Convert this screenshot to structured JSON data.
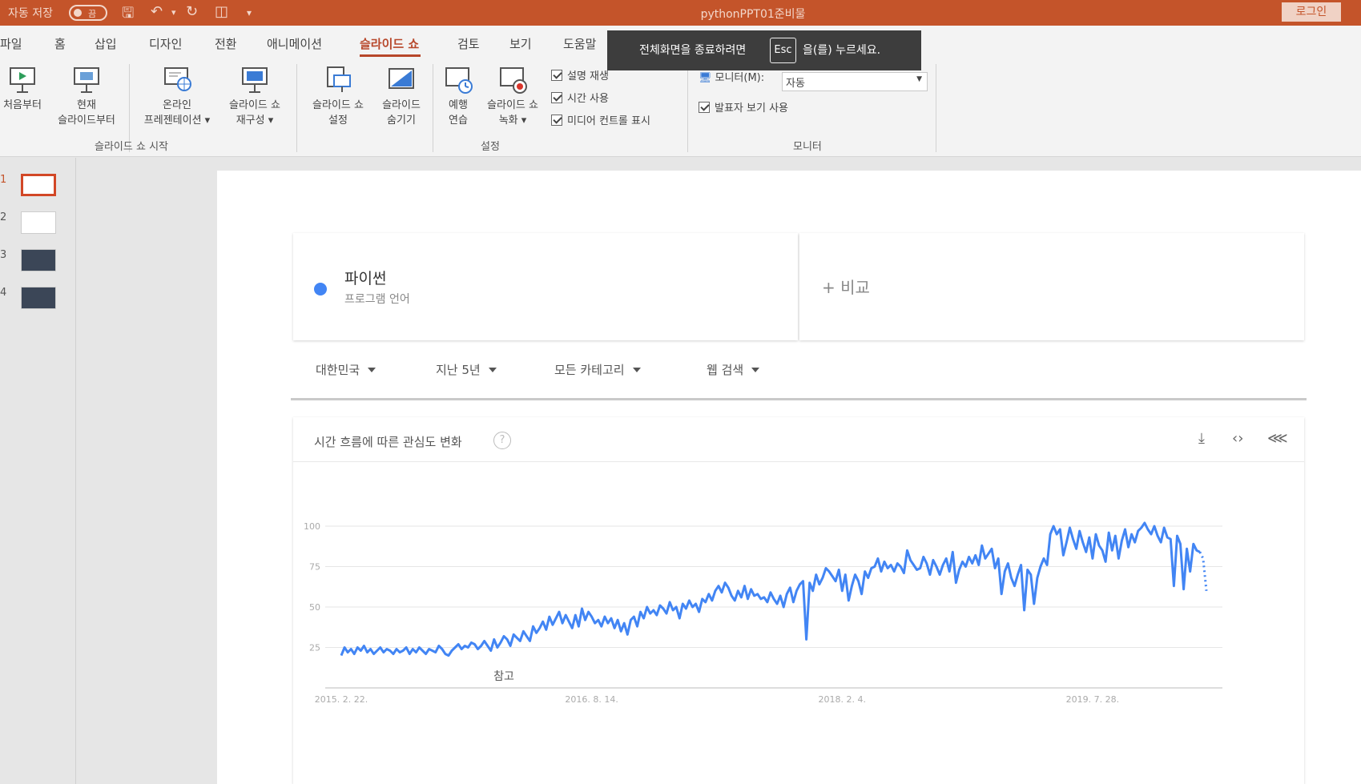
{
  "titlebar": {
    "autosave_label": "자동 저장",
    "toggle_state": "끔",
    "doc_title": "pythonPPT01준비물",
    "login_label": "로그인"
  },
  "ribbon_tabs": [
    "파일",
    "홈",
    "삽입",
    "디자인",
    "전환",
    "애니메이션",
    "슬라이드 쇼",
    "검토",
    "보기",
    "도움말"
  ],
  "active_tab": "슬라이드 쇼",
  "ribbon": {
    "start_group": {
      "label": "슬라이드 쇼 시작",
      "buttons": [
        {
          "line1": "처음부터",
          "line2": ""
        },
        {
          "line1": "현재",
          "line2": "슬라이드부터"
        },
        {
          "line1": "온라인",
          "line2": "프레젠테이션 ▾"
        },
        {
          "line1": "슬라이드 쇼",
          "line2": "재구성 ▾"
        }
      ]
    },
    "setup_group": {
      "label": "설정",
      "buttons": [
        {
          "line1": "슬라이드 쇼",
          "line2": "설정"
        },
        {
          "line1": "슬라이드",
          "line2": "숨기기"
        },
        {
          "line1": "예행",
          "line2": "연습"
        },
        {
          "line1": "슬라이드 쇼",
          "line2": "녹화 ▾"
        }
      ],
      "checkboxes": [
        "설명 재생",
        "시간 사용",
        "미디어 컨트롤 표시"
      ]
    },
    "monitor_group": {
      "label": "모니터",
      "monitor_label": "모니터(M):",
      "monitor_value": "자동",
      "presenter_view": "발표자 보기 사용"
    }
  },
  "esc_tip": {
    "pre": "전체화면을 종료하려면",
    "key": "Esc",
    "post": "을(를) 누르세요."
  },
  "thumbnails": [
    "1",
    "2",
    "3",
    "4"
  ],
  "slide": {
    "term_name": "파이썬",
    "term_sub": "프로그램 언어",
    "compare_label": "+ 비교",
    "filters": [
      "대한민국",
      "지난 5년",
      "모든 카테고리",
      "웹 검색"
    ],
    "chart_title": "시간 흐름에 따른 관심도 변화",
    "annotation": "참고"
  },
  "chart_data": {
    "type": "line",
    "title": "시간 흐름에 따른 관심도 변화",
    "ylim": [
      0,
      100
    ],
    "y_ticks": [
      25,
      50,
      75,
      100
    ],
    "x_tick_labels": [
      "2015. 2. 22.",
      "2016. 8. 14.",
      "2018. 2. 4.",
      "2019. 7. 28."
    ],
    "x_tick_index": [
      0,
      77,
      154,
      231
    ],
    "grid": true,
    "line_color": "#4285f4",
    "series": [
      {
        "values": [
          20,
          25,
          22,
          24,
          21,
          25,
          23,
          26,
          22,
          24,
          21,
          23,
          25,
          22,
          24,
          23,
          21,
          24,
          22,
          23,
          25,
          21,
          24,
          22,
          25,
          23,
          21,
          24,
          23,
          22,
          26,
          24,
          21,
          20,
          23,
          25,
          27,
          24,
          26,
          25,
          28,
          27,
          24,
          26,
          29,
          26,
          23,
          30,
          25,
          28,
          32,
          30,
          26,
          33,
          31,
          29,
          35,
          32,
          29,
          38,
          34,
          37,
          41,
          36,
          44,
          39,
          43,
          47,
          40,
          45,
          41,
          37,
          45,
          38,
          49,
          42,
          47,
          44,
          40,
          42,
          38,
          44,
          40,
          43,
          37,
          42,
          35,
          40,
          33,
          42,
          44,
          38,
          47,
          43,
          50,
          46,
          48,
          45,
          51,
          49,
          46,
          53,
          48,
          50,
          43,
          52,
          49,
          54,
          50,
          52,
          47,
          55,
          53,
          58,
          54,
          60,
          63,
          59,
          65,
          62,
          57,
          54,
          60,
          56,
          63,
          55,
          61,
          57,
          58,
          55,
          56,
          53,
          59,
          55,
          52,
          57,
          50,
          58,
          62,
          53,
          60,
          64,
          66,
          30,
          65,
          60,
          70,
          64,
          68,
          74,
          72,
          69,
          66,
          73,
          60,
          70,
          54,
          63,
          70,
          66,
          58,
          72,
          68,
          74,
          75,
          80,
          72,
          78,
          74,
          76,
          72,
          77,
          75,
          71,
          85,
          79,
          76,
          73,
          74,
          81,
          77,
          70,
          79,
          75,
          70,
          76,
          80,
          72,
          84,
          65,
          73,
          78,
          75,
          81,
          77,
          82,
          76,
          88,
          80,
          83,
          86,
          74,
          80,
          58,
          72,
          77,
          68,
          63,
          70,
          76,
          48,
          73,
          70,
          52,
          68,
          75,
          80,
          76,
          95,
          100,
          95,
          98,
          82,
          90,
          99,
          92,
          86,
          97,
          90,
          84,
          93,
          80,
          95,
          88,
          85,
          78,
          96,
          85,
          94,
          80,
          91,
          98,
          87,
          95,
          90,
          97,
          99,
          102,
          98,
          95,
          100,
          94,
          90,
          99,
          93,
          92,
          63,
          94,
          89,
          61,
          86,
          72,
          89,
          85,
          84
        ],
        "trailing_partial": [
          80,
          60
        ]
      }
    ]
  }
}
